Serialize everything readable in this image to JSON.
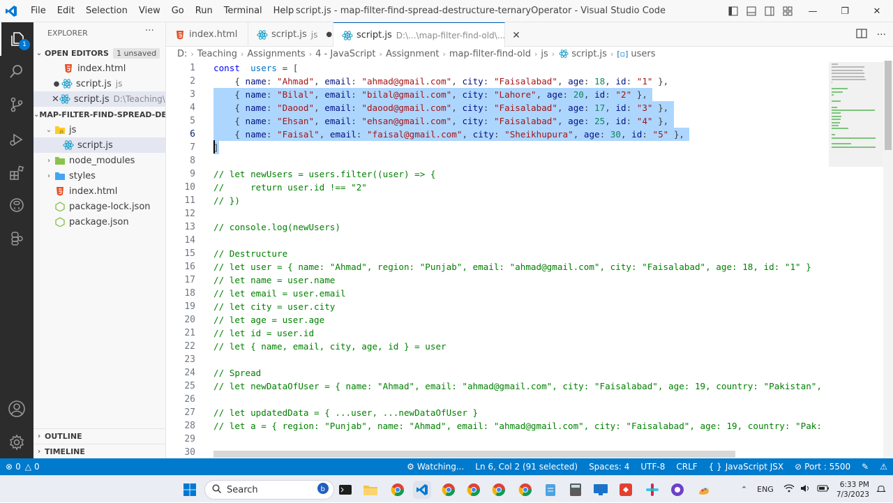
{
  "window": {
    "menu": [
      "File",
      "Edit",
      "Selection",
      "View",
      "Go",
      "Run",
      "Terminal",
      "Help"
    ],
    "title": "script.js - map-filter-find-spread-destructure-ternaryOperator - Visual Studio Code"
  },
  "activity": {
    "badge": "1"
  },
  "sidebar": {
    "title": "EXPLORER",
    "more": "···",
    "open_editors": {
      "label": "OPEN EDITORS",
      "unsaved": "1 unsaved",
      "items": [
        {
          "name": "index.html",
          "desc": ""
        },
        {
          "name": "script.js",
          "desc": "js"
        },
        {
          "name": "script.js",
          "desc": "D:\\Teaching\\..."
        }
      ]
    },
    "project": {
      "label": "MAP-FILTER-FIND-SPREAD-DE...",
      "folders": {
        "js": "js",
        "node_modules": "node_modules",
        "styles": "styles"
      },
      "files": {
        "script": "script.js",
        "index": "index.html",
        "lock": "package-lock.json",
        "pkg": "package.json"
      }
    },
    "outline": "OUTLINE",
    "timeline": "TIMELINE"
  },
  "tabs": [
    {
      "label": "index.html",
      "desc": ""
    },
    {
      "label": "script.js",
      "desc": "js"
    },
    {
      "label": "script.js",
      "desc": "D:\\...\\map-filter-find-old\\..."
    }
  ],
  "breadcrumb": [
    "D:",
    "Teaching",
    "Assignments",
    "4 - JavaScript",
    "Assignment",
    "map-filter-find-old",
    "js",
    "script.js",
    "users"
  ],
  "editor": {
    "line_numbers": [
      1,
      2,
      3,
      4,
      5,
      6,
      7,
      8,
      9,
      10,
      11,
      12,
      13,
      14,
      15,
      16,
      17,
      18,
      19,
      20,
      21,
      22,
      23,
      24,
      25,
      26,
      27,
      28,
      29,
      30
    ],
    "current_line": 6,
    "selection_lines": [
      3,
      7
    ],
    "code": [
      [
        [
          "kw",
          "const"
        ],
        [
          "",
          "  "
        ],
        [
          "var",
          "users"
        ],
        [
          "",
          " = ["
        ]
      ],
      [
        [
          "",
          "    { "
        ],
        [
          "prop",
          "name"
        ],
        [
          "",
          ": "
        ],
        [
          "str",
          "\"Ahmad\""
        ],
        [
          "",
          ", "
        ],
        [
          "prop",
          "email"
        ],
        [
          "",
          ": "
        ],
        [
          "str",
          "\"ahmad@gmail.com\""
        ],
        [
          "",
          ", "
        ],
        [
          "prop",
          "city"
        ],
        [
          "",
          ": "
        ],
        [
          "str",
          "\"Faisalabad\""
        ],
        [
          "",
          ", "
        ],
        [
          "prop",
          "age"
        ],
        [
          "",
          ": "
        ],
        [
          "num",
          "18"
        ],
        [
          "",
          ", "
        ],
        [
          "prop",
          "id"
        ],
        [
          "",
          ": "
        ],
        [
          "str",
          "\"1\""
        ],
        [
          "",
          " },"
        ]
      ],
      [
        [
          "",
          "    { "
        ],
        [
          "prop",
          "name"
        ],
        [
          "",
          ": "
        ],
        [
          "str",
          "\"Bilal\""
        ],
        [
          "",
          ", "
        ],
        [
          "prop",
          "email"
        ],
        [
          "",
          ": "
        ],
        [
          "str",
          "\"bilal@gmail.com\""
        ],
        [
          "",
          ", "
        ],
        [
          "prop",
          "city"
        ],
        [
          "",
          ": "
        ],
        [
          "str",
          "\"Lahore\""
        ],
        [
          "",
          ", "
        ],
        [
          "prop",
          "age"
        ],
        [
          "",
          ": "
        ],
        [
          "num",
          "20"
        ],
        [
          "",
          ", "
        ],
        [
          "prop",
          "id"
        ],
        [
          "",
          ": "
        ],
        [
          "str",
          "\"2\""
        ],
        [
          "",
          " },"
        ]
      ],
      [
        [
          "",
          "    { "
        ],
        [
          "prop",
          "name"
        ],
        [
          "",
          ": "
        ],
        [
          "str",
          "\"Daood\""
        ],
        [
          "",
          ", "
        ],
        [
          "prop",
          "email"
        ],
        [
          "",
          ": "
        ],
        [
          "str",
          "\"daood@gmail.com\""
        ],
        [
          "",
          ", "
        ],
        [
          "prop",
          "city"
        ],
        [
          "",
          ": "
        ],
        [
          "str",
          "\"Faisalabad\""
        ],
        [
          "",
          ", "
        ],
        [
          "prop",
          "age"
        ],
        [
          "",
          ": "
        ],
        [
          "num",
          "17"
        ],
        [
          "",
          ", "
        ],
        [
          "prop",
          "id"
        ],
        [
          "",
          ": "
        ],
        [
          "str",
          "\"3\""
        ],
        [
          "",
          " },"
        ]
      ],
      [
        [
          "",
          "    { "
        ],
        [
          "prop",
          "name"
        ],
        [
          "",
          ": "
        ],
        [
          "str",
          "\"Ehsan\""
        ],
        [
          "",
          ", "
        ],
        [
          "prop",
          "email"
        ],
        [
          "",
          ": "
        ],
        [
          "str",
          "\"ehsan@gmail.com\""
        ],
        [
          "",
          ", "
        ],
        [
          "prop",
          "city"
        ],
        [
          "",
          ": "
        ],
        [
          "str",
          "\"Faisalabad\""
        ],
        [
          "",
          ", "
        ],
        [
          "prop",
          "age"
        ],
        [
          "",
          ": "
        ],
        [
          "num",
          "25"
        ],
        [
          "",
          ", "
        ],
        [
          "prop",
          "id"
        ],
        [
          "",
          ": "
        ],
        [
          "str",
          "\"4\""
        ],
        [
          "",
          " },"
        ]
      ],
      [
        [
          "",
          "    { "
        ],
        [
          "prop",
          "name"
        ],
        [
          "",
          ": "
        ],
        [
          "str",
          "\"Faisal\""
        ],
        [
          "",
          ", "
        ],
        [
          "prop",
          "email"
        ],
        [
          "",
          ": "
        ],
        [
          "str",
          "\"faisal@gmail.com\""
        ],
        [
          "",
          ", "
        ],
        [
          "prop",
          "city"
        ],
        [
          "",
          ": "
        ],
        [
          "str",
          "\"Sheikhupura\""
        ],
        [
          "",
          ", "
        ],
        [
          "prop",
          "age"
        ],
        [
          "",
          ": "
        ],
        [
          "num",
          "30"
        ],
        [
          "",
          ", "
        ],
        [
          "prop",
          "id"
        ],
        [
          "",
          ": "
        ],
        [
          "str",
          "\"5\""
        ],
        [
          "",
          " },"
        ]
      ],
      [
        [
          "",
          "]"
        ]
      ],
      [],
      [
        [
          "cm",
          "// let newUsers = users.filter((user) => {"
        ]
      ],
      [
        [
          "cm",
          "//     return user.id !== \"2\""
        ]
      ],
      [
        [
          "cm",
          "// })"
        ]
      ],
      [],
      [
        [
          "cm",
          "// console.log(newUsers)"
        ]
      ],
      [],
      [
        [
          "cm",
          "// Destructure"
        ]
      ],
      [
        [
          "cm",
          "// let user = { name: \"Ahmad\", region: \"Punjab\", email: \"ahmad@gmail.com\", city: \"Faisalabad\", age: 18, id: \"1\" }"
        ]
      ],
      [
        [
          "cm",
          "// let name = user.name"
        ]
      ],
      [
        [
          "cm",
          "// let email = user.email"
        ]
      ],
      [
        [
          "cm",
          "// let city = user.city"
        ]
      ],
      [
        [
          "cm",
          "// let age = user.age"
        ]
      ],
      [
        [
          "cm",
          "// let id = user.id"
        ]
      ],
      [
        [
          "cm",
          "// let { name, email, city, age, id } = user"
        ]
      ],
      [],
      [
        [
          "cm",
          "// Spread"
        ]
      ],
      [
        [
          "cm",
          "// let newDataOfUser = { name: \"Ahmad\", email: \"ahmad@gmail.com\", city: \"Faisalabad\", age: 19, country: \"Pakistan\","
        ]
      ],
      [],
      [
        [
          "cm",
          "// let updatedData = { ...user, ...newDataOfUser }"
        ]
      ],
      [
        [
          "cm",
          "// let a = { region: \"Punjab\", name: \"Ahmad\", email: \"ahmad@gmail.com\", city: \"Faisalabad\", age: 19, country: \"Pak:"
        ]
      ],
      [],
      []
    ]
  },
  "status": {
    "errors": "0",
    "warnings": "0",
    "watching": "Watching...",
    "position": "Ln 6, Col 2 (91 selected)",
    "spaces": "Spaces: 4",
    "encoding": "UTF-8",
    "eol": "CRLF",
    "language": "JavaScript JSX",
    "port": "Port : 5500"
  },
  "taskbar": {
    "search": "Search",
    "lang": "ENG",
    "time": "6:33 PM",
    "date": "7/3/2023"
  },
  "colors": {
    "statusbar": "#007acc",
    "activitybar": "#2c2c2c",
    "selection": "#add6ff",
    "accent": "#005fb8"
  }
}
